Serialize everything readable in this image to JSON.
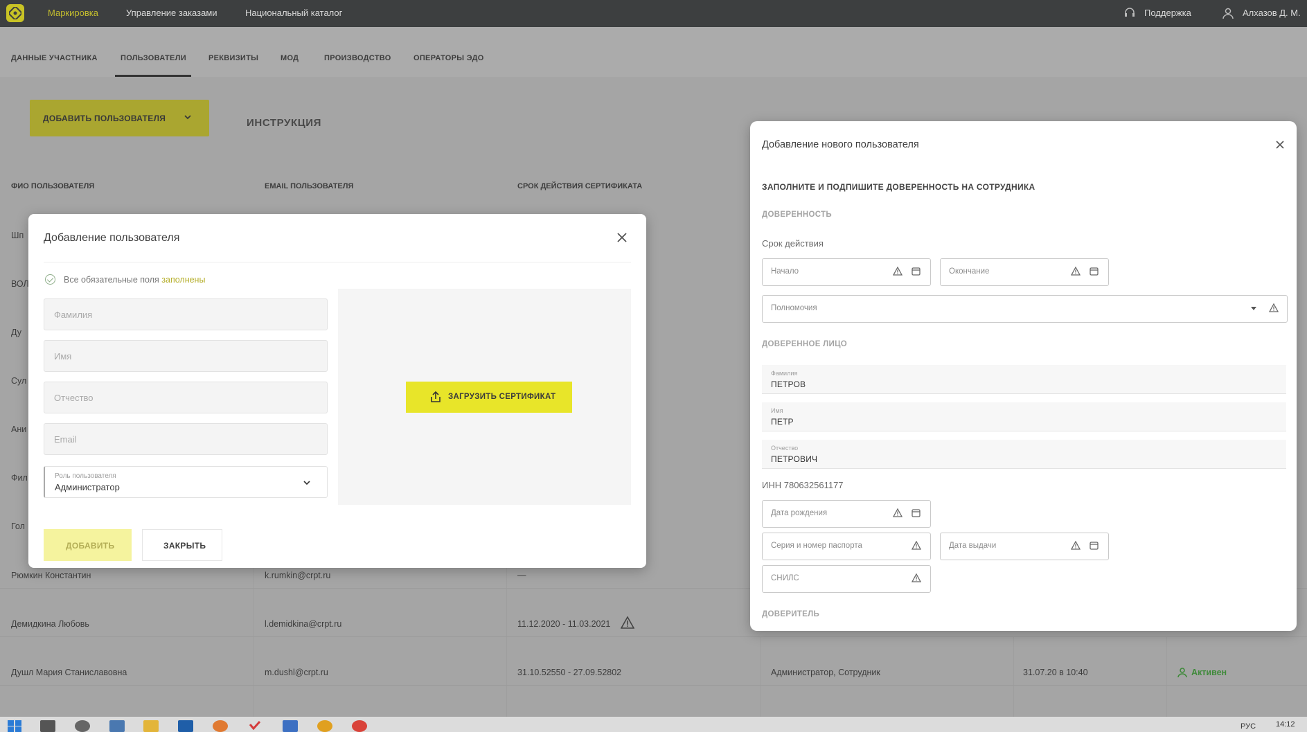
{
  "topnav": {
    "items": [
      "Маркировка",
      "Управление заказами",
      "Национальный каталог"
    ],
    "support": "Поддержка",
    "user": "Алхазов Д. М."
  },
  "subnav": {
    "items": [
      "ДАННЫЕ УЧАСТНИКА",
      "ПОЛЬЗОВАТЕЛИ",
      "РЕКВИЗИТЫ",
      "МОД",
      "ПРОИЗВОДСТВО",
      "ОПЕРАТОРЫ ЭДО"
    ]
  },
  "actions": {
    "add_user": "ДОБАВИТЬ ПОЛЬЗОВАТЕЛЯ",
    "instruction": "ИНСТРУКЦИЯ"
  },
  "table": {
    "headers": [
      "ФИО ПОЛЬЗОВАТЕЛЯ",
      "EMAIL ПОЛЬЗОВАТЕЛЯ",
      "СРОК ДЕЙСТВИЯ СЕРТИФИКАТА"
    ],
    "partial_names": [
      "Шп",
      "ВОЛ",
      "Ду",
      "Сул",
      "Ани",
      "Фил",
      "Гол"
    ],
    "rows": [
      {
        "name": "Рюмкин Константин",
        "email": "k.rumkin@crpt.ru",
        "cert": "—"
      },
      {
        "name": "Демидкина Любовь",
        "email": "l.demidkina@crpt.ru",
        "cert": "11.12.2020 - 11.03.2021"
      },
      {
        "name": "Душл Мария Станиславовна",
        "email": "m.dushl@crpt.ru",
        "cert": "31.10.52550 - 27.09.52802",
        "role": "Администратор, Сотрудник",
        "date": "31.07.20 в 10:40",
        "status": "Активен"
      }
    ]
  },
  "modal_add": {
    "title": "Добавление пользователя",
    "status_prefix": "Все обязательные поля",
    "status_link": "заполнены",
    "fields": {
      "last_name": "Фамилия",
      "first_name": "Имя",
      "middle_name": "Отчество",
      "email": "Email"
    },
    "role_label": "Роль пользователя",
    "role_value": "Администратор",
    "upload": "ЗАГРУЗИТЬ СЕРТИФИКАТ",
    "add": "ДОБАВИТЬ",
    "close": "ЗАКРЫТЬ"
  },
  "modal_new": {
    "title": "Добавление нового пользователя",
    "heading": "ЗАПОЛНИТЕ И ПОДПИШИТЕ ДОВЕРЕННОСТЬ НА СОТРУДНИКА",
    "section_poa": "ДОВЕРЕННОСТЬ",
    "validity": "Срок действия",
    "start": "Начало",
    "end": "Окончание",
    "powers": "Полномочия",
    "section_attorney": "ДОВЕРЕННОЕ ЛИЦО",
    "last_name_label": "Фамилия",
    "last_name": "ПЕТРОВ",
    "first_name_label": "Имя",
    "first_name": "ПЕТР",
    "middle_name_label": "Отчество",
    "middle_name": "ПЕТРОВИЧ",
    "inn": "ИНН 780632561177",
    "birth_date": "Дата рождения",
    "passport": "Серия и номер паспорта",
    "issue_date": "Дата выдачи",
    "snils": "СНИЛС",
    "section_principal": "ДОВЕРИТЕЛЬ"
  },
  "taskbar": {
    "time": "14:12",
    "lang": "РУС"
  },
  "colors": {
    "accent": "#e8e529",
    "topbar": "#3d3f40",
    "status_active": "#3f8a3a"
  }
}
